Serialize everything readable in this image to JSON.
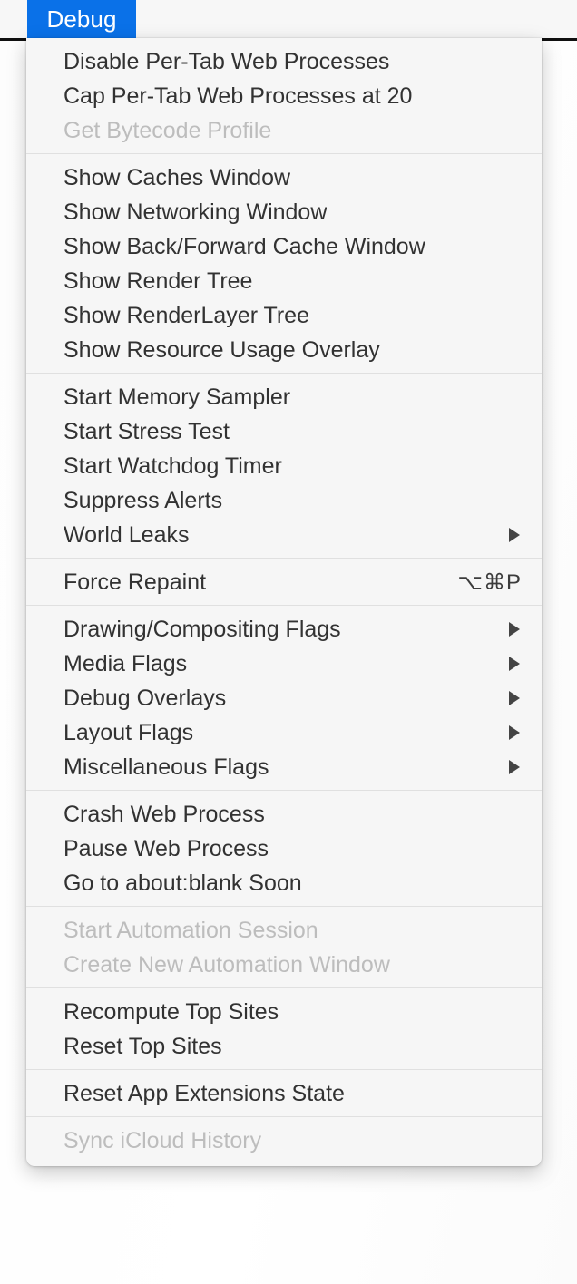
{
  "menubar": {
    "active_menu_label": "Debug",
    "highlight_color": "#0a71e8"
  },
  "menu": {
    "name": "Debug",
    "sections": [
      {
        "items": [
          {
            "label": "Disable Per-Tab Web Processes",
            "enabled": true
          },
          {
            "label": "Cap Per-Tab Web Processes at 20",
            "enabled": true
          },
          {
            "label": "Get Bytecode Profile",
            "enabled": false
          }
        ]
      },
      {
        "items": [
          {
            "label": "Show Caches Window",
            "enabled": true
          },
          {
            "label": "Show Networking Window",
            "enabled": true
          },
          {
            "label": "Show Back/Forward Cache Window",
            "enabled": true
          },
          {
            "label": "Show Render Tree",
            "enabled": true
          },
          {
            "label": "Show RenderLayer Tree",
            "enabled": true
          },
          {
            "label": "Show Resource Usage Overlay",
            "enabled": true
          }
        ]
      },
      {
        "items": [
          {
            "label": "Start Memory Sampler",
            "enabled": true
          },
          {
            "label": "Start Stress Test",
            "enabled": true
          },
          {
            "label": "Start Watchdog Timer",
            "enabled": true
          },
          {
            "label": "Suppress Alerts",
            "enabled": true
          },
          {
            "label": "World Leaks",
            "enabled": true,
            "submenu": true
          }
        ]
      },
      {
        "items": [
          {
            "label": "Force Repaint",
            "enabled": true,
            "shortcut": "⌥⌘P"
          }
        ]
      },
      {
        "items": [
          {
            "label": "Drawing/Compositing Flags",
            "enabled": true,
            "submenu": true
          },
          {
            "label": "Media Flags",
            "enabled": true,
            "submenu": true
          },
          {
            "label": "Debug Overlays",
            "enabled": true,
            "submenu": true
          },
          {
            "label": "Layout Flags",
            "enabled": true,
            "submenu": true
          },
          {
            "label": "Miscellaneous Flags",
            "enabled": true,
            "submenu": true
          }
        ]
      },
      {
        "items": [
          {
            "label": "Crash Web Process",
            "enabled": true
          },
          {
            "label": "Pause Web Process",
            "enabled": true
          },
          {
            "label": "Go to about:blank Soon",
            "enabled": true
          }
        ]
      },
      {
        "items": [
          {
            "label": "Start Automation Session",
            "enabled": false
          },
          {
            "label": "Create New Automation Window",
            "enabled": false
          }
        ]
      },
      {
        "items": [
          {
            "label": "Recompute Top Sites",
            "enabled": true
          },
          {
            "label": "Reset Top Sites",
            "enabled": true
          }
        ]
      },
      {
        "items": [
          {
            "label": "Reset App Extensions State",
            "enabled": true
          }
        ]
      },
      {
        "items": [
          {
            "label": "Sync iCloud History",
            "enabled": false
          }
        ]
      }
    ]
  },
  "icons": {
    "submenu_arrow": "triangle-right-icon"
  },
  "colors": {
    "menu_background": "#f6f6f6",
    "separator": "#e0e0e0",
    "text_enabled": "#323232",
    "text_disabled": "#bdbdbd",
    "menubar_background": "#f7f7f7",
    "window_edge": "#101010"
  }
}
